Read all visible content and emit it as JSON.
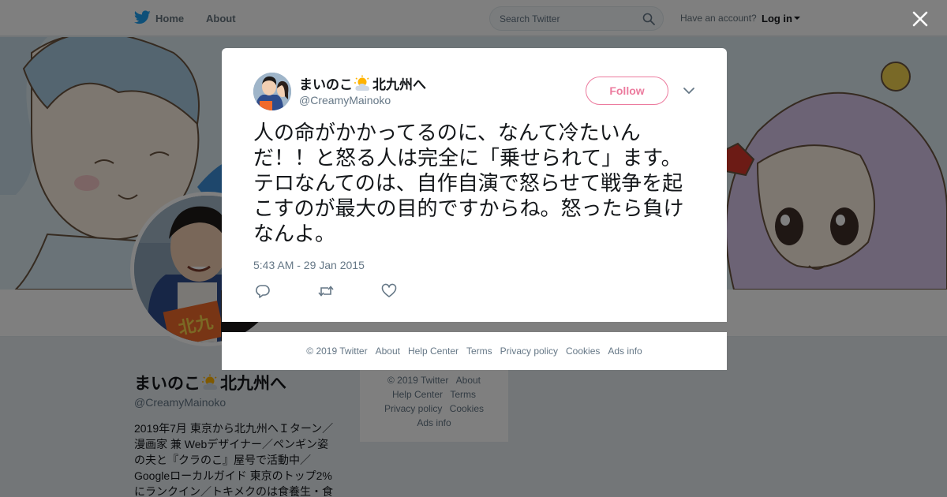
{
  "topbar": {
    "home_label": "Home",
    "about_label": "About",
    "search_placeholder": "Search Twitter",
    "have_account": "Have an account?",
    "login_label": "Log in"
  },
  "profile": {
    "name": "まいのこ",
    "name_suffix": "北九州へ",
    "handle": "@CreamyMainoko",
    "bio": "2019年7月 東京から北九州へＩターン／漫画家 兼 Webデザイナー／ペンギン姿の夫と『クラのこ』屋号で活動中／Googleローカルガイド 東京のトップ2%にランクイン／トキメクのは食養生・食"
  },
  "side_footer": {
    "copyright": "© 2019 Twitter",
    "about": "About",
    "help": "Help Center",
    "terms": "Terms",
    "privacy": "Privacy policy",
    "cookies": "Cookies",
    "ads": "Ads info"
  },
  "tweet": {
    "author_name": "まいのこ",
    "author_name_suffix": "北九州へ",
    "author_handle": "@CreamyMainoko",
    "follow_label": "Follow",
    "text": "人の命がかかってるのに、なんて冷たいんだ！！と怒る人は完全に「乗せられて」ます。テロなんてのは、自作自演で怒らせて戦争を起こすのが最大の目的ですからね。怒ったら負けなんよ。",
    "timestamp": "5:43 AM - 29 Jan 2015"
  },
  "modal_footer": {
    "copyright": "© 2019 Twitter",
    "about": "About",
    "help": "Help Center",
    "terms": "Terms",
    "privacy": "Privacy policy",
    "cookies": "Cookies",
    "ads": "Ads info"
  },
  "colors": {
    "twitter_blue": "#1da1f2",
    "follow_pink": "#e0245e",
    "text_secondary": "#657786"
  },
  "icons": {
    "logo": "twitter-bird-icon",
    "search": "search-icon",
    "close": "close-icon",
    "name_emoji": "sun-behind-cloud-icon",
    "reply": "reply-icon",
    "retweet": "retweet-icon",
    "like": "heart-icon",
    "more": "chevron-down-icon"
  }
}
